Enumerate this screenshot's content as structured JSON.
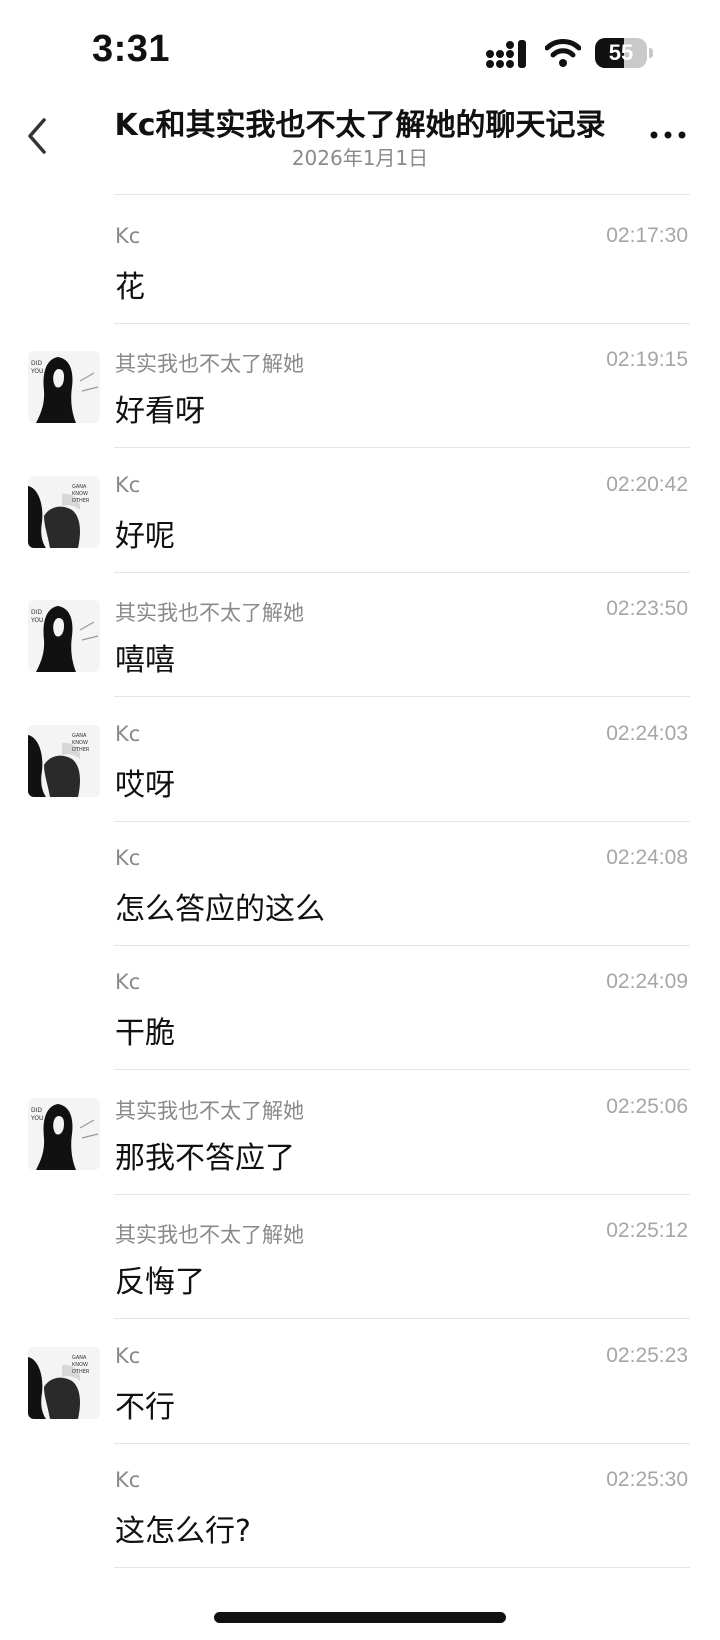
{
  "status_bar": {
    "time": "3:31",
    "battery": "55",
    "battery_level": 0.55
  },
  "header": {
    "title": "Kc和其实我也不太了解她的聊天记录",
    "date": "2026年1月1日"
  },
  "icons": {
    "back": "chevron-left-icon",
    "more": "more-horizontal-icon"
  },
  "messages": [
    {
      "sender": "Kc",
      "time": "02:17:30",
      "text": "花",
      "avatar": "none"
    },
    {
      "sender": "其实我也不太了解她",
      "time": "02:19:15",
      "text": "好看呀",
      "avatar": "her"
    },
    {
      "sender": "Kc",
      "time": "02:20:42",
      "text": "好呢",
      "avatar": "kc"
    },
    {
      "sender": "其实我也不太了解她",
      "time": "02:23:50",
      "text": "嘻嘻",
      "avatar": "her"
    },
    {
      "sender": "Kc",
      "time": "02:24:03",
      "text": "哎呀",
      "avatar": "kc"
    },
    {
      "sender": "Kc",
      "time": "02:24:08",
      "text": "怎么答应的这么",
      "avatar": "none"
    },
    {
      "sender": "Kc",
      "time": "02:24:09",
      "text": "干脆",
      "avatar": "none"
    },
    {
      "sender": "其实我也不太了解她",
      "time": "02:25:06",
      "text": "那我不答应了",
      "avatar": "her"
    },
    {
      "sender": "其实我也不太了解她",
      "time": "02:25:12",
      "text": "反悔了",
      "avatar": "none"
    },
    {
      "sender": "Kc",
      "time": "02:25:23",
      "text": "不行",
      "avatar": "kc"
    },
    {
      "sender": "Kc",
      "time": "02:25:30",
      "text": "这怎么行?",
      "avatar": "none"
    }
  ]
}
